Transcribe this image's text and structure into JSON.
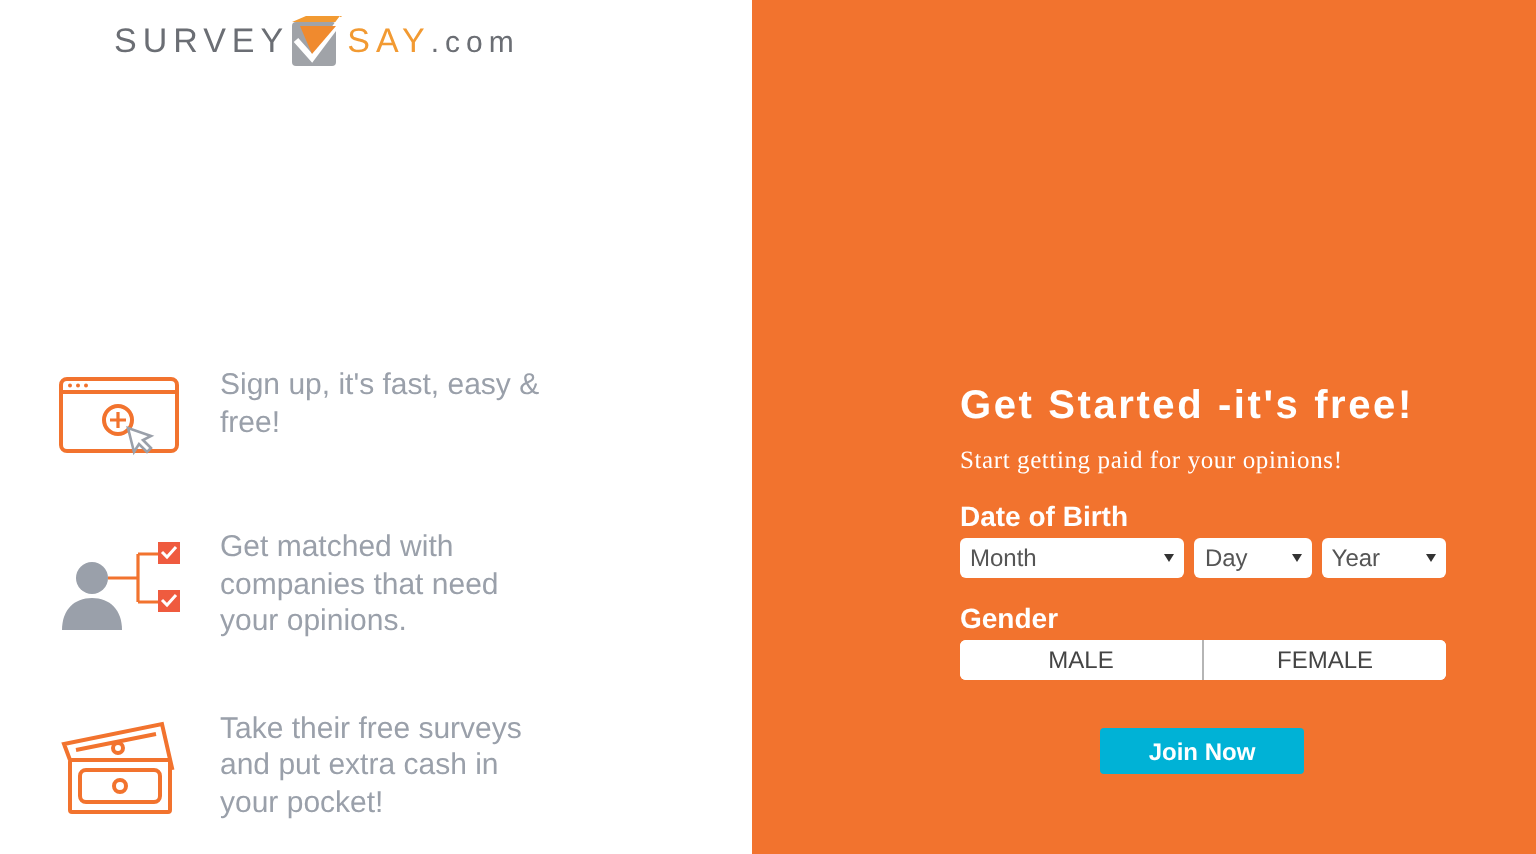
{
  "logo": {
    "word_1": "SURVEY",
    "word_2": "SAY",
    "suffix": ".com"
  },
  "features": [
    {
      "kind": "signup",
      "text": "Sign up, it's fast, easy & free!"
    },
    {
      "kind": "match",
      "text": "Get matched with companies that need your opinions."
    },
    {
      "kind": "cash",
      "text": "Take their free surveys and put extra cash in your pocket!"
    }
  ],
  "form": {
    "title": "Get Started -it's free!",
    "subtitle": "Start getting paid for your opinions!",
    "dob_label": "Date of Birth",
    "selects": [
      {
        "placeholder": "Month"
      },
      {
        "placeholder": "Day"
      },
      {
        "placeholder": "Year"
      }
    ],
    "gender_label": "Gender",
    "genders": [
      {
        "label": "MALE",
        "selected": false
      },
      {
        "label": "FEMALE",
        "selected": false
      }
    ],
    "submit": "Join Now"
  }
}
